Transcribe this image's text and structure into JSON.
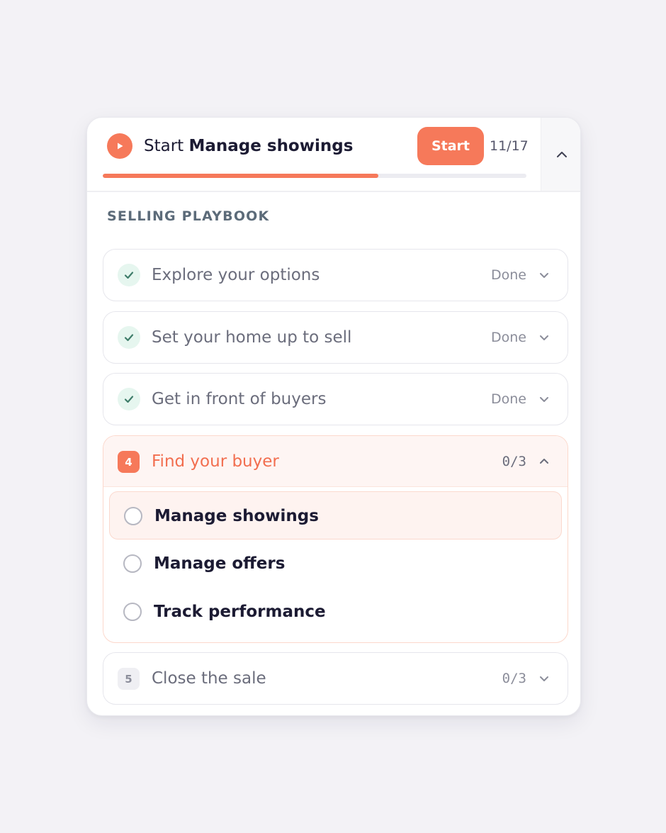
{
  "header": {
    "title_prefix": "Start",
    "title_task": "Manage showings",
    "start_label": "Start",
    "progress_text": "11/17",
    "progress_fraction": 0.65,
    "icon": "play-icon",
    "toggle_icon": "chevron-up-icon"
  },
  "section": {
    "label": "SELLING PLAYBOOK"
  },
  "steps": [
    {
      "title": "Explore your options",
      "status": "Done",
      "state": "done"
    },
    {
      "title": "Set your home up to sell",
      "status": "Done",
      "state": "done"
    },
    {
      "title": "Get in front of buyers",
      "status": "Done",
      "state": "done"
    },
    {
      "number": "4",
      "title": "Find your buyer",
      "status": "0/3",
      "state": "active",
      "substeps": [
        {
          "label": "Manage showings",
          "current": true
        },
        {
          "label": "Manage offers",
          "current": false
        },
        {
          "label": "Track performance",
          "current": false
        }
      ]
    },
    {
      "number": "5",
      "title": "Close the sale",
      "status": "0/3",
      "state": "upcoming"
    }
  ],
  "colors": {
    "accent": "#f6795a",
    "active_text": "#f26e4f",
    "done_check": "#3f7d6a",
    "background": "#f3f2f6"
  }
}
